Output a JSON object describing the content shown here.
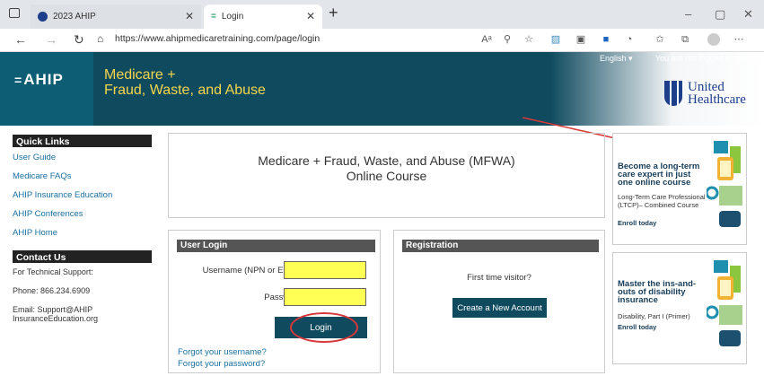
{
  "browser": {
    "tabs": [
      {
        "label": "2023 AHIP"
      },
      {
        "label": "Login"
      }
    ],
    "url": "https://www.ahipmedicaretraining.com/page/login",
    "window_controls": {
      "min": "–",
      "max": "▢",
      "close": "✕"
    }
  },
  "banner": {
    "logo": "AHIP",
    "title_line1": "Medicare +",
    "title_line2": "Fraud, Waste, and Abuse",
    "language": "English ▾",
    "login_status": "You are not logged in. (Log in)",
    "partner_logo_line1": "United",
    "partner_logo_line2": "Healthcare"
  },
  "sidebar": {
    "quick_links_heading": "Quick Links",
    "links": [
      {
        "label": "User Guide"
      },
      {
        "label": "Medicare FAQs"
      },
      {
        "label": "AHIP Insurance Education"
      },
      {
        "label": "AHIP Conferences"
      },
      {
        "label": "AHIP Home"
      }
    ],
    "contact_heading": "Contact Us",
    "tech_support": "For Technical Support:",
    "phone": "Phone: 866.234.6909",
    "email_line1": "Email: Support@AHIP",
    "email_line2": "InsuranceEducation.org"
  },
  "course": {
    "title_line1": "Medicare + Fraud, Waste, and Abuse (MFWA)",
    "title_line2": "Online Course"
  },
  "login": {
    "heading": "User Login",
    "username_label": "Username (NPN or Email)",
    "password_label": "Password",
    "username_value": "",
    "password_value": "",
    "button": "Login",
    "forgot_username": "Forgot your username?",
    "forgot_password": "Forgot your password?"
  },
  "registration": {
    "heading": "Registration",
    "first_time": "First time visitor?",
    "button": "Create a New Account"
  },
  "ads": [
    {
      "title": "Become a long-term care expert in just one online course",
      "subtitle": "Long-Term Care Professional (LTCP)– Combined Course",
      "cta": "Enroll today"
    },
    {
      "title": "Master the ins-and-outs of disability insurance",
      "subtitle": "Disability, Part I (Primer)",
      "cta": "Enroll today"
    }
  ],
  "colors": {
    "banner": "#0f4a5e",
    "title": "#f5d64b",
    "input_highlight": "#ffff54",
    "annotation": "#d9383a"
  }
}
